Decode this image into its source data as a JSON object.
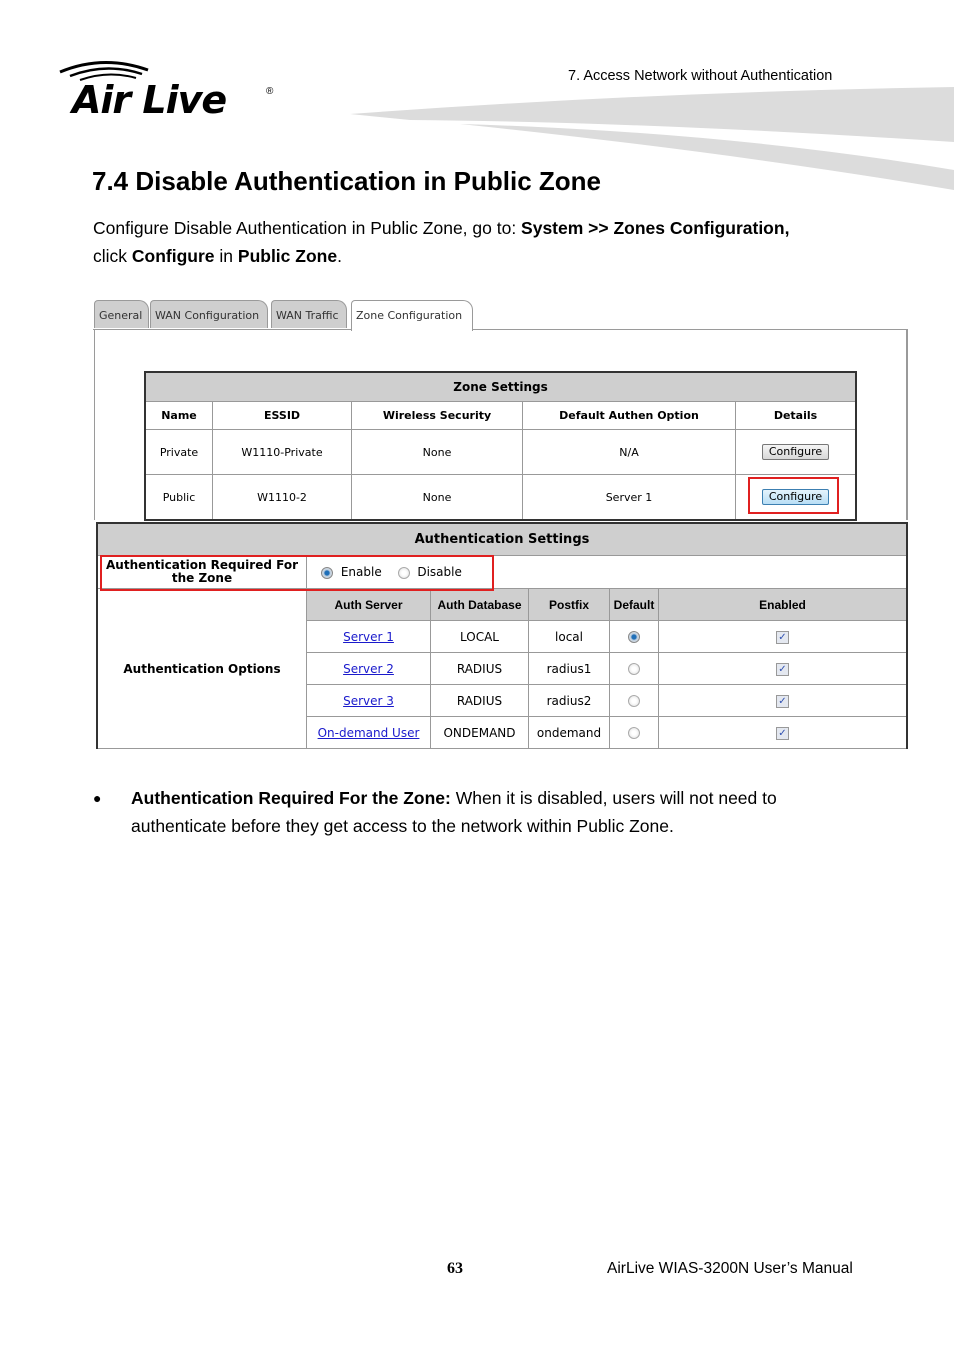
{
  "header": {
    "logo_text": "Air Live",
    "logo_registered": "®",
    "chapter_title": "7. Access Network without Authentication"
  },
  "section": {
    "title": "7.4 Disable Authentication in Public Zone",
    "intro_prefix": "Configure Disable Authentication in Public Zone, go to: ",
    "intro_path": "System >> Zones Configuration,",
    "intro_click": "click ",
    "intro_configure": "Configure",
    "intro_in": " in ",
    "intro_zone": "Public Zone",
    "intro_end": "."
  },
  "screenshot": {
    "tabs": [
      {
        "label": "General",
        "active": false
      },
      {
        "label": "WAN Configuration",
        "active": false
      },
      {
        "label": "WAN Traffic",
        "active": false
      },
      {
        "label": "Zone Configuration",
        "active": true
      }
    ],
    "zone_settings": {
      "caption": "Zone Settings",
      "columns": [
        "Name",
        "ESSID",
        "Wireless Security",
        "Default Authen Option",
        "Details"
      ],
      "rows": [
        {
          "name": "Private",
          "essid": "W1110-Private",
          "security": "None",
          "authen": "N/A",
          "action": "Configure"
        },
        {
          "name": "Public",
          "essid": "W1110-2",
          "security": "None",
          "authen": "Server 1",
          "action": "Configure"
        }
      ]
    },
    "auth_settings": {
      "caption": "Authentication Settings",
      "required_label": "Authentication Required For the Zone",
      "enable_label": "Enable",
      "disable_label": "Disable",
      "required_value": "Enable",
      "options_label": "Authentication Options",
      "columns": [
        "Auth Server",
        "Auth Database",
        "Postfix",
        "Default",
        "Enabled"
      ],
      "rows": [
        {
          "server": "Server 1",
          "database": "LOCAL",
          "postfix": "local",
          "default": true,
          "enabled": true
        },
        {
          "server": "Server 2",
          "database": "RADIUS",
          "postfix": "radius1",
          "default": false,
          "enabled": true
        },
        {
          "server": "Server 3",
          "database": "RADIUS",
          "postfix": "radius2",
          "default": false,
          "enabled": true
        },
        {
          "server": "On-demand User",
          "database": "ONDEMAND",
          "postfix": "ondemand",
          "default": false,
          "enabled": true
        }
      ]
    },
    "highlight_color": "#e02020"
  },
  "bullet": {
    "term": "Authentication Required For the Zone:",
    "text": " When it is disabled, users will not need to authenticate before they get access to the network within Public Zone."
  },
  "footer": {
    "page_number": "63",
    "manual_title": "AirLive WIAS-3200N User’s Manual"
  }
}
